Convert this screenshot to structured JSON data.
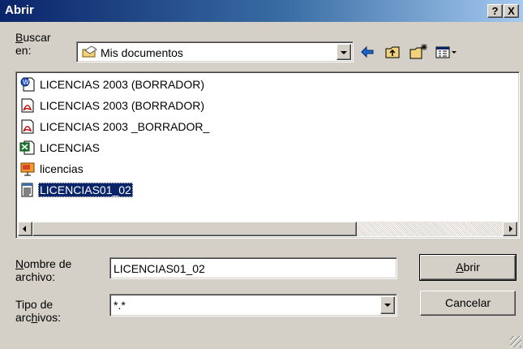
{
  "window": {
    "title": "Abrir",
    "help_button": "?",
    "close_button": "X"
  },
  "lookin": {
    "label_line1": "Buscar",
    "label_line2": "en:",
    "value": "Mis documentos"
  },
  "toolbar": {
    "icons": [
      "back-arrow-icon",
      "up-folder-icon",
      "new-folder-icon",
      "view-menu-icon"
    ]
  },
  "files": [
    {
      "name": "LICENCIAS 2003 (BORRADOR)",
      "icon": "word-doc-icon"
    },
    {
      "name": "LICENCIAS 2003 (BORRADOR)",
      "icon": "pdf-icon"
    },
    {
      "name": "LICENCIAS 2003 _BORRADOR_",
      "icon": "pdf-icon"
    },
    {
      "name": "LICENCIAS",
      "icon": "excel-icon"
    },
    {
      "name": "licencias",
      "icon": "presentation-icon"
    },
    {
      "name": "LICENCIAS01_02",
      "icon": "text-file-icon",
      "selected": true
    }
  ],
  "filename": {
    "label_line1": "Nombre de",
    "label_line2": "archivo:",
    "value": "LICENCIAS01_02"
  },
  "filetype": {
    "label_line1": "Tipo de",
    "label_line2": "archivos:",
    "value": "*.*"
  },
  "buttons": {
    "open": "Abrir",
    "cancel": "Cancelar"
  },
  "colors": {
    "selection": "#0a246a",
    "dialog_bg": "#d4d0c8"
  }
}
